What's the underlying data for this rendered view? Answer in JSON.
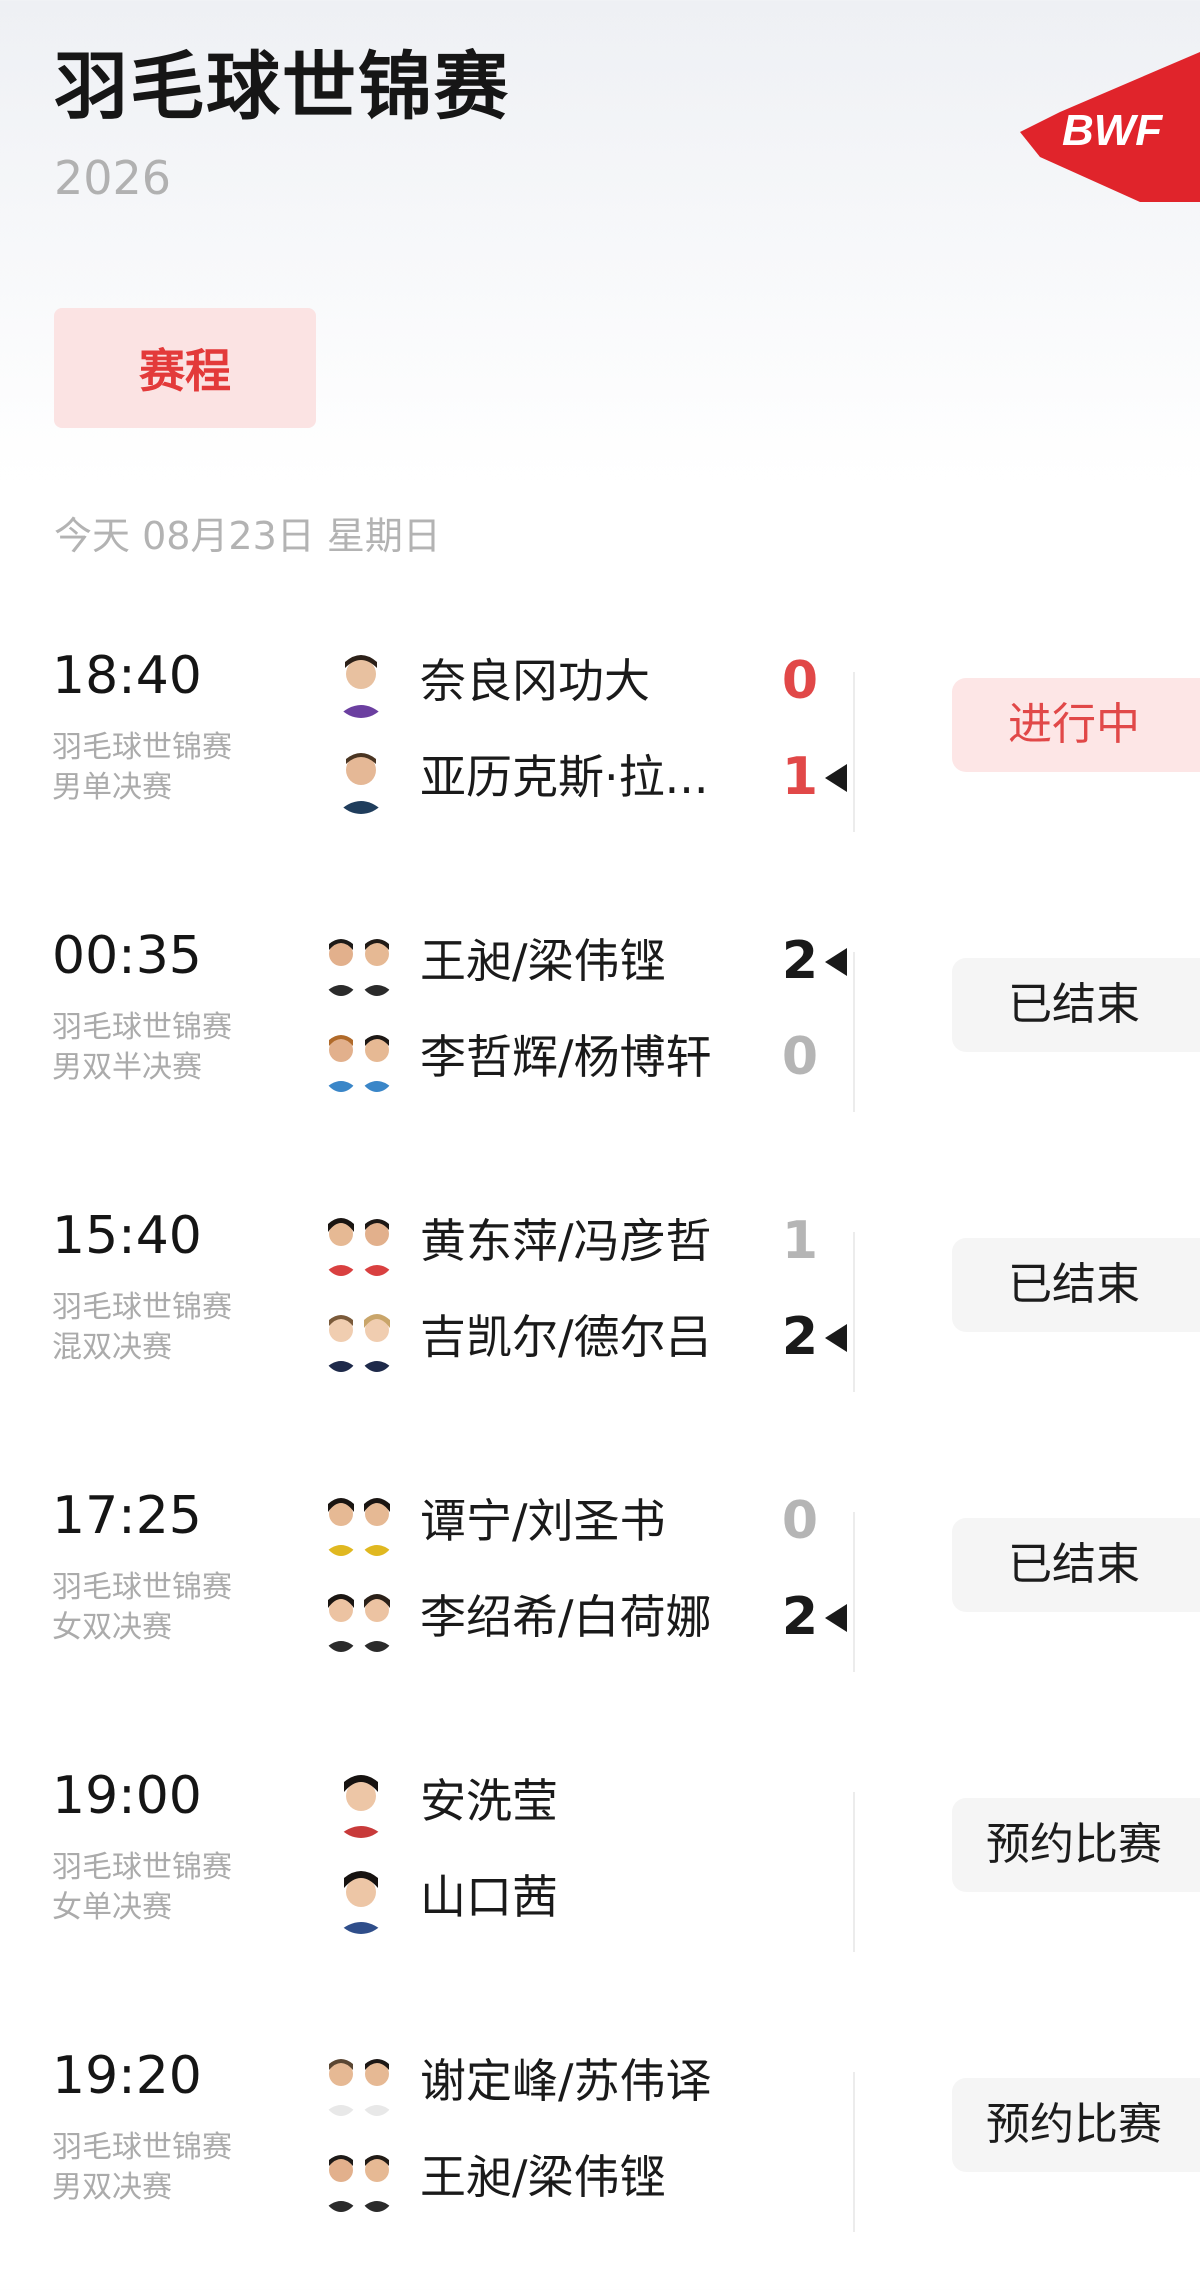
{
  "header": {
    "title": "羽毛球世锦赛",
    "year": "2026",
    "logo_text": "BWF",
    "tab_label": "赛程",
    "date_line": "今天 08月23日 星期日"
  },
  "colors": {
    "accent_red": "#e33a3a",
    "live_bg": "#fde6e6",
    "status_bg": "#f5f5f5",
    "muted_text": "#ababab",
    "winner_score": "#1a1a1a",
    "loser_score": "#b5b5b5"
  },
  "matches": [
    {
      "time": "18:40",
      "event": "羽毛球世锦赛\n男单决赛",
      "event_line1": "羽毛球世锦赛",
      "event_line2": "男单决赛",
      "status": "进行中",
      "players": [
        {
          "name": "奈良冈功大",
          "score": "0",
          "avatar_icon": "player-avatar-icon"
        },
        {
          "name": "亚历克斯·拉...",
          "score": "1",
          "avatar_icon": "player-avatar-icon"
        }
      ]
    },
    {
      "time": "00:35",
      "event_line1": "羽毛球世锦赛",
      "event_line2": "男双半决赛",
      "status": "已结束",
      "players": [
        {
          "name": "王昶/梁伟铿",
          "score": "2",
          "avatar_icon": "pair-avatar-icon"
        },
        {
          "name": "李哲辉/杨博轩",
          "score": "0",
          "avatar_icon": "pair-avatar-icon"
        }
      ]
    },
    {
      "time": "15:40",
      "event_line1": "羽毛球世锦赛",
      "event_line2": "混双决赛",
      "status": "已结束",
      "players": [
        {
          "name": "黄东萍/冯彦哲",
          "score": "1",
          "avatar_icon": "pair-avatar-icon"
        },
        {
          "name": "吉凯尔/德尔吕",
          "score": "2",
          "avatar_icon": "pair-avatar-icon"
        }
      ]
    },
    {
      "time": "17:25",
      "event_line1": "羽毛球世锦赛",
      "event_line2": "女双决赛",
      "status": "已结束",
      "players": [
        {
          "name": "谭宁/刘圣书",
          "score": "0",
          "avatar_icon": "pair-avatar-icon"
        },
        {
          "name": "李绍希/白荷娜",
          "score": "2",
          "avatar_icon": "pair-avatar-icon"
        }
      ]
    },
    {
      "time": "19:00",
      "event_line1": "羽毛球世锦赛",
      "event_line2": "女单决赛",
      "status": "预约比赛",
      "players": [
        {
          "name": "安洗莹",
          "score": "",
          "avatar_icon": "player-avatar-icon"
        },
        {
          "name": "山口茜",
          "score": "",
          "avatar_icon": "player-avatar-icon"
        }
      ]
    },
    {
      "time": "19:20",
      "event_line1": "羽毛球世锦赛",
      "event_line2": "男双决赛",
      "status": "预约比赛",
      "players": [
        {
          "name": "谢定峰/苏伟译",
          "score": "",
          "avatar_icon": "pair-avatar-icon"
        },
        {
          "name": "王昶/梁伟铿",
          "score": "",
          "avatar_icon": "pair-avatar-icon"
        }
      ]
    }
  ]
}
